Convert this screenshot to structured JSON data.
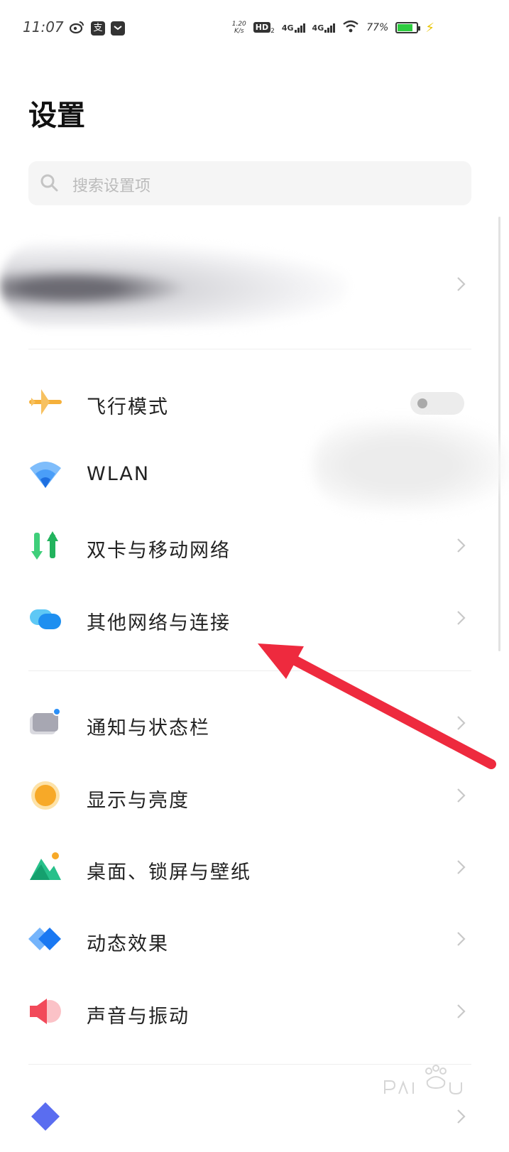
{
  "status_bar": {
    "time": "11:07",
    "left_app_icons": [
      "weibo-icon",
      "alipay-icon",
      "mail-icon"
    ],
    "alipay_glyph": "支",
    "net_speed": "1.20",
    "net_speed_unit": "K/s",
    "hd_badge": "HD",
    "hd_sub": "2",
    "network_1": "4G",
    "network_2": "4G",
    "battery_percent": "77%"
  },
  "page": {
    "title": "设置"
  },
  "search": {
    "placeholder": "搜索设置项"
  },
  "settings_items": [
    {
      "label": "飞行模式",
      "icon": "airplane-icon",
      "control": "toggle",
      "toggle_on": false
    },
    {
      "label": "WLAN",
      "icon": "wifi-icon",
      "control": "none"
    },
    {
      "label": "双卡与移动网络",
      "icon": "dual-sim-icon",
      "control": "chevron"
    },
    {
      "label": "其他网络与连接",
      "icon": "other-connections-icon",
      "control": "chevron"
    },
    {
      "label": "通知与状态栏",
      "icon": "notification-icon",
      "control": "chevron"
    },
    {
      "label": "显示与亮度",
      "icon": "display-brightness-icon",
      "control": "chevron"
    },
    {
      "label": "桌面、锁屏与壁纸",
      "icon": "wallpaper-icon",
      "control": "chevron"
    },
    {
      "label": "动态效果",
      "icon": "animation-icon",
      "control": "chevron"
    },
    {
      "label": "声音与振动",
      "icon": "sound-icon",
      "control": "chevron"
    }
  ],
  "colors": {
    "annotation_arrow": "#ee2a3e",
    "airplane": "#f5b03a",
    "wifi": "#3a8ef6",
    "display": "#f7a928"
  }
}
